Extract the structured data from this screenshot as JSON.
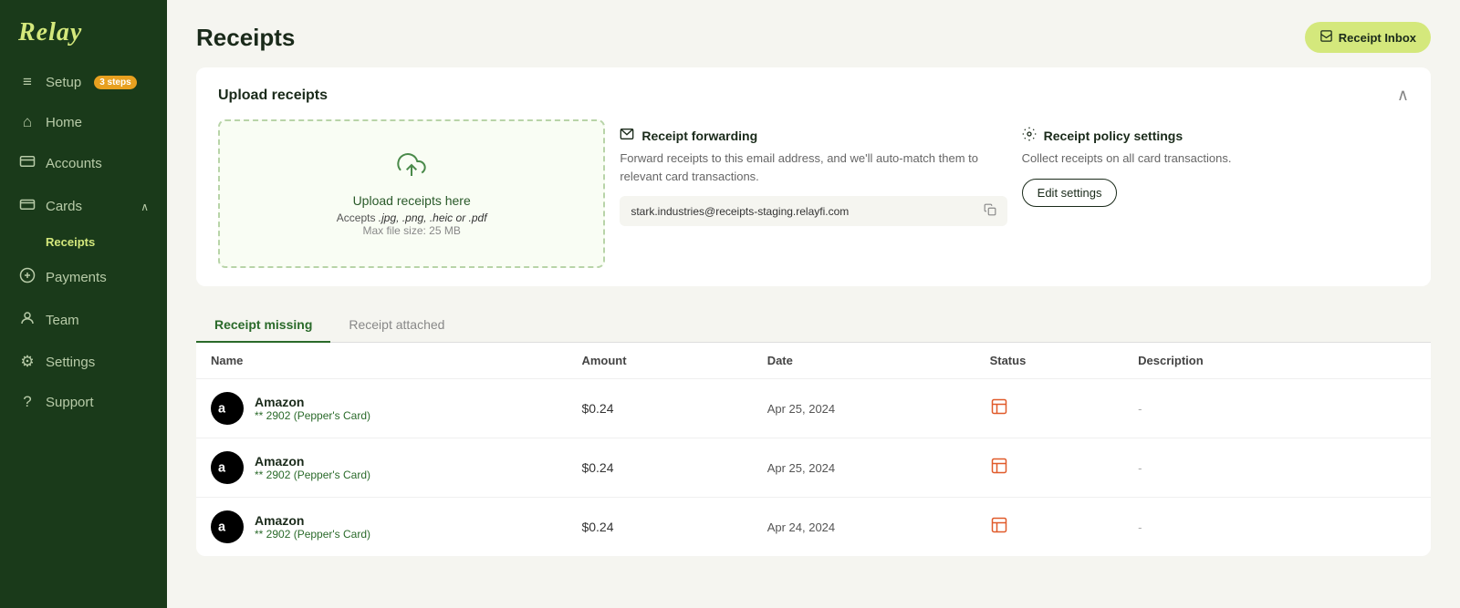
{
  "sidebar": {
    "logo": "Relay",
    "items": [
      {
        "id": "setup",
        "label": "Setup",
        "icon": "≡",
        "badge": "3 steps"
      },
      {
        "id": "home",
        "label": "Home",
        "icon": "⌂"
      },
      {
        "id": "accounts",
        "label": "Accounts",
        "icon": "◫"
      },
      {
        "id": "cards",
        "label": "Cards",
        "icon": "▭",
        "chevron": "∧",
        "expanded": true
      },
      {
        "id": "receipts-sub",
        "label": "Receipts",
        "sub": true
      },
      {
        "id": "payments",
        "label": "Payments",
        "icon": "◎"
      },
      {
        "id": "team",
        "label": "Team",
        "icon": "◯"
      },
      {
        "id": "settings",
        "label": "Settings",
        "icon": "⚙"
      },
      {
        "id": "support",
        "label": "Support",
        "icon": "?"
      }
    ]
  },
  "header": {
    "title": "Receipts",
    "receipt_inbox_button": "Receipt Inbox"
  },
  "upload_section": {
    "title": "Upload receipts",
    "dropzone": {
      "main_text": "Upload receipts here",
      "sub_text_prefix": "Accepts ",
      "formats": ".jpg, .png, .heic or .pdf",
      "max_size": "Max file size: 25 MB"
    },
    "forwarding": {
      "title": "Receipt forwarding",
      "description": "Forward receipts to this email address, and we'll auto-match them to relevant card transactions.",
      "email": "stark.industries@receipts-staging.relayfi.com"
    },
    "policy": {
      "title": "Receipt policy settings",
      "description": "Collect receipts on all card transactions.",
      "edit_button": "Edit settings"
    }
  },
  "tabs": [
    {
      "id": "missing",
      "label": "Receipt missing",
      "active": true
    },
    {
      "id": "attached",
      "label": "Receipt attached",
      "active": false
    }
  ],
  "table": {
    "headers": [
      "Name",
      "Amount",
      "Date",
      "Status",
      "Description"
    ],
    "rows": [
      {
        "merchant": "Amazon",
        "card": "** 2902 (Pepper's Card)",
        "amount": "$0.24",
        "date": "Apr 25, 2024",
        "description": "-"
      },
      {
        "merchant": "Amazon",
        "card": "** 2902 (Pepper's Card)",
        "amount": "$0.24",
        "date": "Apr 25, 2024",
        "description": "-"
      },
      {
        "merchant": "Amazon",
        "card": "** 2902 (Pepper's Card)",
        "amount": "$0.24",
        "date": "Apr 24, 2024",
        "description": "-"
      }
    ]
  }
}
